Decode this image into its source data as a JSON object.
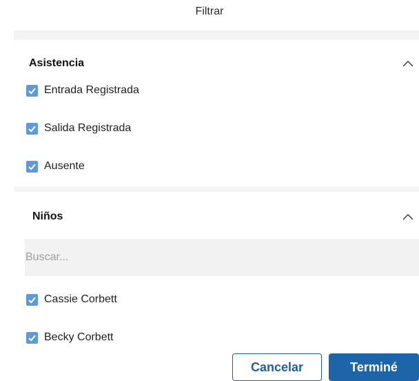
{
  "dialog": {
    "title": "Filtrar"
  },
  "attendance": {
    "title": "Asistencia",
    "items": [
      {
        "label": "Entrada Registrada",
        "checked": true
      },
      {
        "label": "Salida Registrada",
        "checked": true
      },
      {
        "label": "Ausente",
        "checked": true
      }
    ]
  },
  "children": {
    "title": "Niños",
    "search_placeholder": "Buscar...",
    "search_value": "",
    "items": [
      {
        "label": "Cassie Corbett",
        "checked": true
      },
      {
        "label": "Becky Corbett",
        "checked": true
      }
    ]
  },
  "buttons": {
    "cancel_label": "Cancelar",
    "done_label": "Terminé"
  },
  "colors": {
    "checkbox": "#5e9ad5",
    "primary": "#1e64a8",
    "band": "#f3f3f3"
  },
  "icons": {
    "section_toggle": "chevron-up-icon",
    "check": "check-icon"
  }
}
